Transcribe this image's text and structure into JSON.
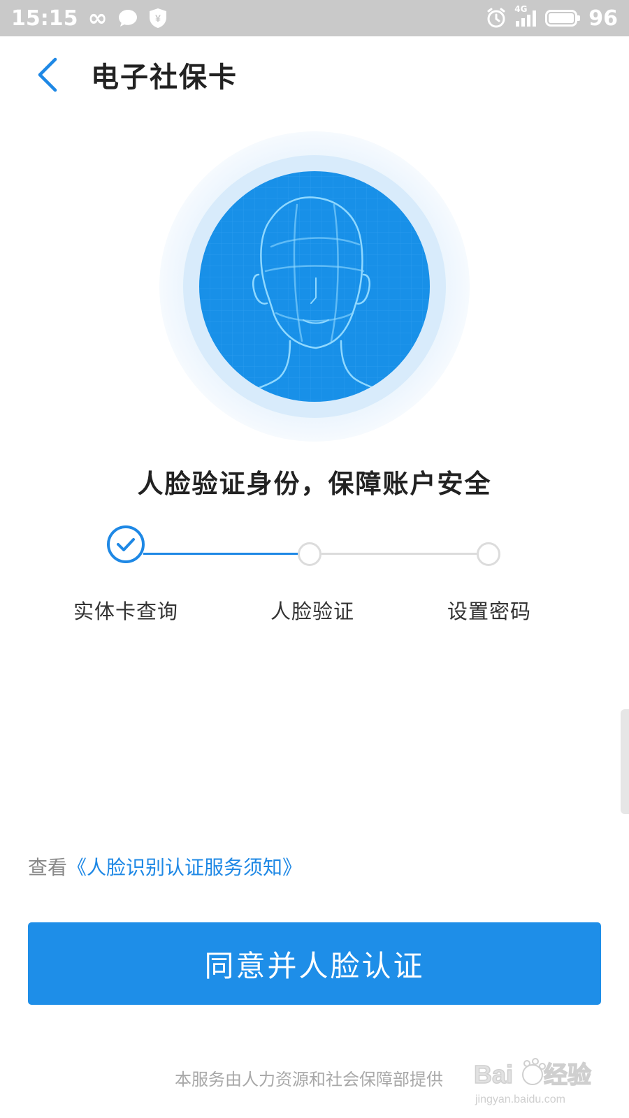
{
  "status_bar": {
    "time": "15:15",
    "infinity_glyph": "∞",
    "network": "4G",
    "battery": "96",
    "battery_level": 0.96
  },
  "header": {
    "title": "电子社保卡",
    "back_icon": "chevron-left-icon"
  },
  "illustration": {
    "icon": "face-scan-icon"
  },
  "headline": "人脸验证身份，保障账户安全",
  "steps": [
    {
      "label": "实体卡查询",
      "state": "done"
    },
    {
      "label": "人脸验证",
      "state": "current"
    },
    {
      "label": "设置密码",
      "state": "pending"
    }
  ],
  "terms": {
    "prefix": "查看",
    "link": "《人脸识别认证服务须知》"
  },
  "agree_button": "同意并人脸认证",
  "footer_note": "本服务由人力资源和社会保障部提供",
  "watermark": {
    "brand": "Baidu经验",
    "url": "jingyan.baidu.com"
  },
  "colors": {
    "accent": "#1e8ee8",
    "link": "#1e88e5",
    "step_done": "#1e88e5",
    "step_pending": "#dcdcdc",
    "status_bar": "#c9c9c9"
  }
}
